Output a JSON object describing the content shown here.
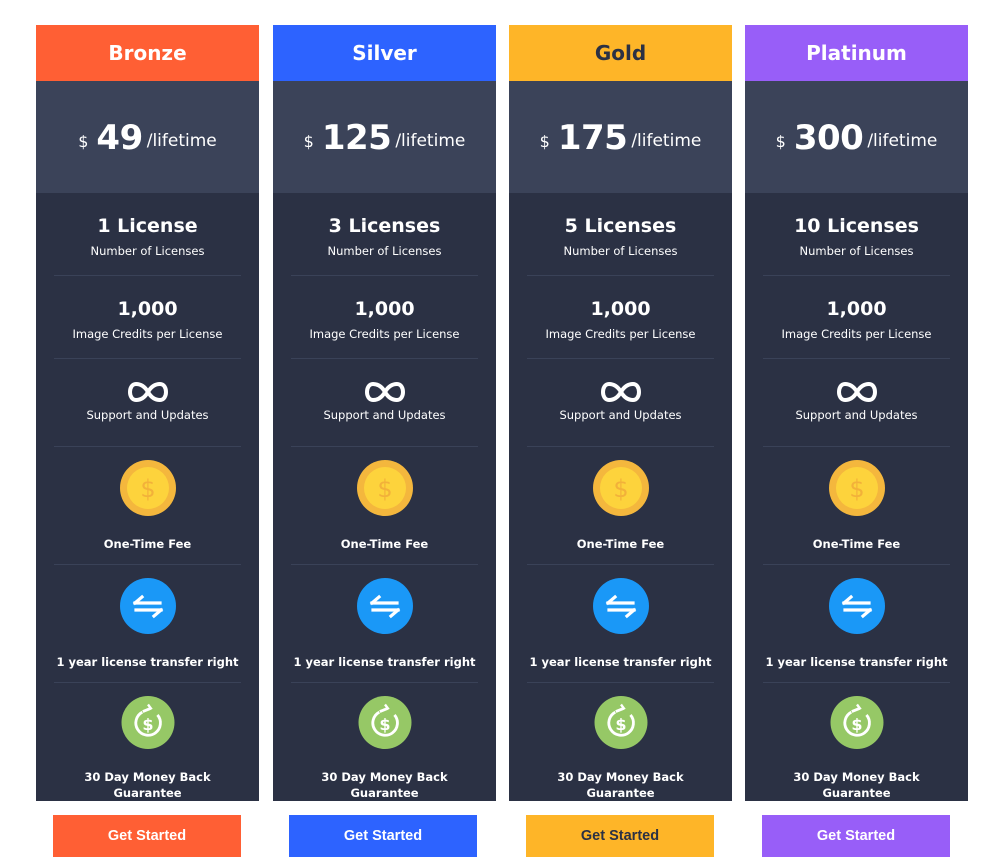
{
  "plans": [
    {
      "name": "Bronze",
      "color": "#ff5f34",
      "header_text_color": "#ffffff",
      "currency": "$",
      "price": "49",
      "period": "/lifetime",
      "licenses_value": "1 License",
      "licenses_label": "Number of Licenses",
      "credits_value": "1,000",
      "credits_label": "Image Credits per License",
      "support_icon": "infinity-icon",
      "support_label": "Support and Updates",
      "fee_icon": "coin-dollar-icon",
      "fee_label": "One-Time Fee",
      "transfer_icon": "transfer-arrows-icon",
      "transfer_label": "1 year license transfer right",
      "guarantee_icon": "money-back-icon",
      "guarantee_label": "30 Day Money Back Guarantee",
      "button_label": "Get Started",
      "button_text_color": "#ffffff"
    },
    {
      "name": "Silver",
      "color": "#2d63ff",
      "header_text_color": "#ffffff",
      "currency": "$",
      "price": "125",
      "period": "/lifetime",
      "licenses_value": "3 Licenses",
      "licenses_label": "Number of Licenses",
      "credits_value": "1,000",
      "credits_label": "Image Credits per License",
      "support_icon": "infinity-icon",
      "support_label": "Support and Updates",
      "fee_icon": "coin-dollar-icon",
      "fee_label": "One-Time Fee",
      "transfer_icon": "transfer-arrows-icon",
      "transfer_label": "1 year license transfer right",
      "guarantee_icon": "money-back-icon",
      "guarantee_label": "30 Day Money Back Guarantee",
      "button_label": "Get Started",
      "button_text_color": "#ffffff"
    },
    {
      "name": "Gold",
      "color": "#feb528",
      "header_text_color": "#2b3144",
      "currency": "$",
      "price": "175",
      "period": "/lifetime",
      "licenses_value": "5 Licenses",
      "licenses_label": "Number of Licenses",
      "credits_value": "1,000",
      "credits_label": "Image Credits per License",
      "support_icon": "infinity-icon",
      "support_label": "Support and Updates",
      "fee_icon": "coin-dollar-icon",
      "fee_label": "One-Time Fee",
      "transfer_icon": "transfer-arrows-icon",
      "transfer_label": "1 year license transfer right",
      "guarantee_icon": "money-back-icon",
      "guarantee_label": "30 Day Money Back Guarantee",
      "button_label": "Get Started",
      "button_text_color": "#2b3144"
    },
    {
      "name": "Platinum",
      "color": "#985ef8",
      "header_text_color": "#ffffff",
      "currency": "$",
      "price": "300",
      "period": "/lifetime",
      "licenses_value": "10 Licenses",
      "licenses_label": "Number of Licenses",
      "credits_value": "1,000",
      "credits_label": "Image Credits per License",
      "support_icon": "infinity-icon",
      "support_label": "Support and Updates",
      "fee_icon": "coin-dollar-icon",
      "fee_label": "One-Time Fee",
      "transfer_icon": "transfer-arrows-icon",
      "transfer_label": "1 year license transfer right",
      "guarantee_icon": "money-back-icon",
      "guarantee_label": "30 Day Money Back Guarantee",
      "button_label": "Get Started",
      "button_text_color": "#ffffff"
    }
  ],
  "colors": {
    "card_body": "#2b3144",
    "price_band": "#3b4359",
    "coin_outer": "#f4b73d",
    "coin_inner": "#fdd33c",
    "transfer_bg": "#1a98f7",
    "guarantee_bg": "#96c866"
  }
}
